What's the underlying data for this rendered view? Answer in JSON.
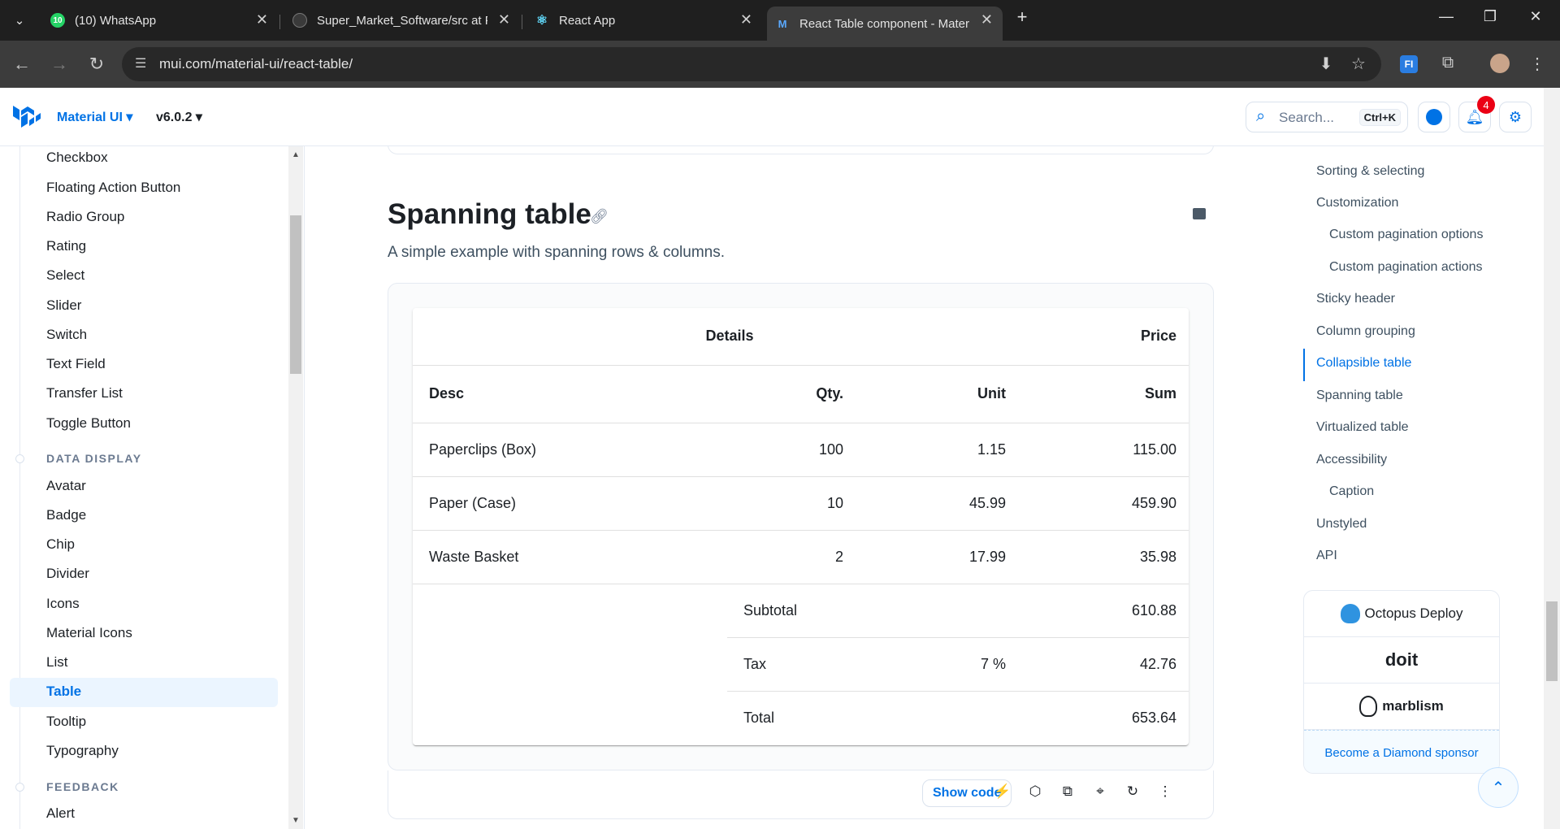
{
  "browser": {
    "tabs": [
      {
        "title": "(10) WhatsApp",
        "badge": "10"
      },
      {
        "title": "Super_Market_Software/src at F"
      },
      {
        "title": "React App"
      },
      {
        "title": "React Table component - Mater"
      }
    ],
    "new_tab": "+",
    "url": "mui.com/material-ui/react-table/"
  },
  "header": {
    "product": "Material UI ▾",
    "version": "v6.0.2 ▾",
    "search_placeholder": "Search...",
    "search_shortcut": "Ctrl+K",
    "notifications_count": "4"
  },
  "sidebar": {
    "items_top": [
      "Checkbox",
      "Floating Action Button",
      "Radio Group",
      "Rating",
      "Select",
      "Slider",
      "Switch",
      "Text Field",
      "Transfer List",
      "Toggle Button"
    ],
    "section_data_display": "DATA DISPLAY",
    "items_data": [
      "Avatar",
      "Badge",
      "Chip",
      "Divider",
      "Icons",
      "Material Icons",
      "List",
      "Table",
      "Tooltip",
      "Typography"
    ],
    "selected": "Table",
    "section_feedback": "FEEDBACK",
    "items_feedback": [
      "Alert"
    ]
  },
  "main": {
    "title": "Spanning table",
    "description": "A simple example with spanning rows & columns.",
    "table": {
      "group_headers": {
        "details": "Details",
        "price": "Price"
      },
      "columns": {
        "desc": "Desc",
        "qty": "Qty.",
        "unit": "Unit",
        "sum": "Sum"
      },
      "rows": [
        {
          "desc": "Paperclips (Box)",
          "qty": "100",
          "unit": "1.15",
          "sum": "115.00"
        },
        {
          "desc": "Paper (Case)",
          "qty": "10",
          "unit": "45.99",
          "sum": "459.90"
        },
        {
          "desc": "Waste Basket",
          "qty": "2",
          "unit": "17.99",
          "sum": "35.98"
        }
      ],
      "subtotal_label": "Subtotal",
      "subtotal": "610.88",
      "tax_label": "Tax",
      "tax_rate": "7 %",
      "tax": "42.76",
      "total_label": "Total",
      "total": "653.64"
    },
    "show_code": "Show code"
  },
  "toc": {
    "items": [
      {
        "label": "Sorting & selecting",
        "level": 1
      },
      {
        "label": "Customization",
        "level": 1
      },
      {
        "label": "Custom pagination options",
        "level": 2
      },
      {
        "label": "Custom pagination actions",
        "level": 2
      },
      {
        "label": "Sticky header",
        "level": 1
      },
      {
        "label": "Column grouping",
        "level": 1
      },
      {
        "label": "Collapsible table",
        "level": 1
      },
      {
        "label": "Spanning table",
        "level": 1
      },
      {
        "label": "Virtualized table",
        "level": 1
      },
      {
        "label": "Accessibility",
        "level": 1
      },
      {
        "label": "Caption",
        "level": 2
      },
      {
        "label": "Unstyled",
        "level": 1
      },
      {
        "label": "API",
        "level": 1
      }
    ],
    "active": "Collapsible table",
    "sponsors": [
      "Octopus Deploy",
      "doit",
      "marblism"
    ],
    "sponsor_cta": "Become a Diamond sponsor"
  },
  "colors": {
    "brand": "#0072e5",
    "badge": "#eb0014"
  }
}
